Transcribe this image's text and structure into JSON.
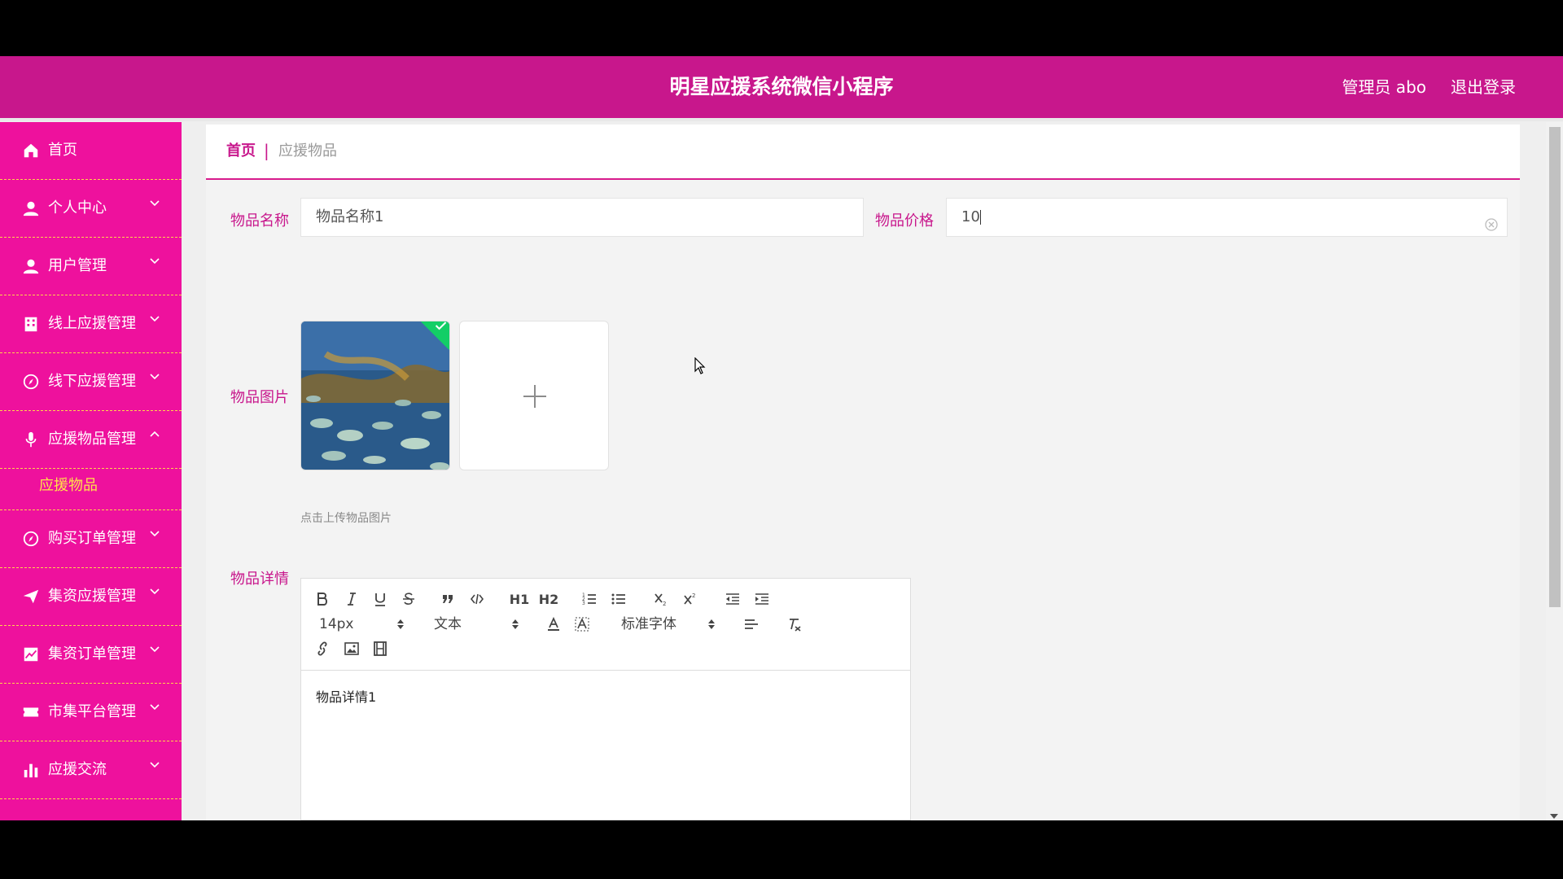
{
  "header": {
    "title": "明星应援系统微信小程序",
    "user": "管理员 abo",
    "logout": "退出登录"
  },
  "sidebar": {
    "items": [
      {
        "label": "首页",
        "icon": "home-icon"
      },
      {
        "label": "个人中心",
        "icon": "user-icon"
      },
      {
        "label": "用户管理",
        "icon": "user-icon"
      },
      {
        "label": "线上应援管理",
        "icon": "building-icon"
      },
      {
        "label": "线下应援管理",
        "icon": "compass-icon"
      },
      {
        "label": "应援物品管理",
        "icon": "mic-icon"
      },
      {
        "label": "购买订单管理",
        "icon": "compass-icon"
      },
      {
        "label": "集资应援管理",
        "icon": "send-icon"
      },
      {
        "label": "集资订单管理",
        "icon": "chart-icon"
      },
      {
        "label": "市集平台管理",
        "icon": "ticket-icon"
      },
      {
        "label": "应援交流",
        "icon": "bar-chart-icon"
      }
    ],
    "active_sub": "应援物品"
  },
  "breadcrumb": {
    "home": "首页",
    "separator": "|",
    "current": "应援物品"
  },
  "form": {
    "name_label": "物品名称",
    "name_value": "物品名称1",
    "price_label": "物品价格",
    "price_value": "10",
    "image_label": "物品图片",
    "upload_tip": "点击上传物品图片",
    "detail_label": "物品详情",
    "detail_content": "物品详情1"
  },
  "editor": {
    "size": "14px",
    "header_picker": "文本",
    "font_picker": "标准字体",
    "h1": "H1",
    "h2": "H2"
  },
  "colors": {
    "brand": "#c8178c",
    "sidebar": "#ee119d",
    "divider": "#ffd54a",
    "active_sub": "#ffe14a",
    "success": "#13ce66"
  }
}
